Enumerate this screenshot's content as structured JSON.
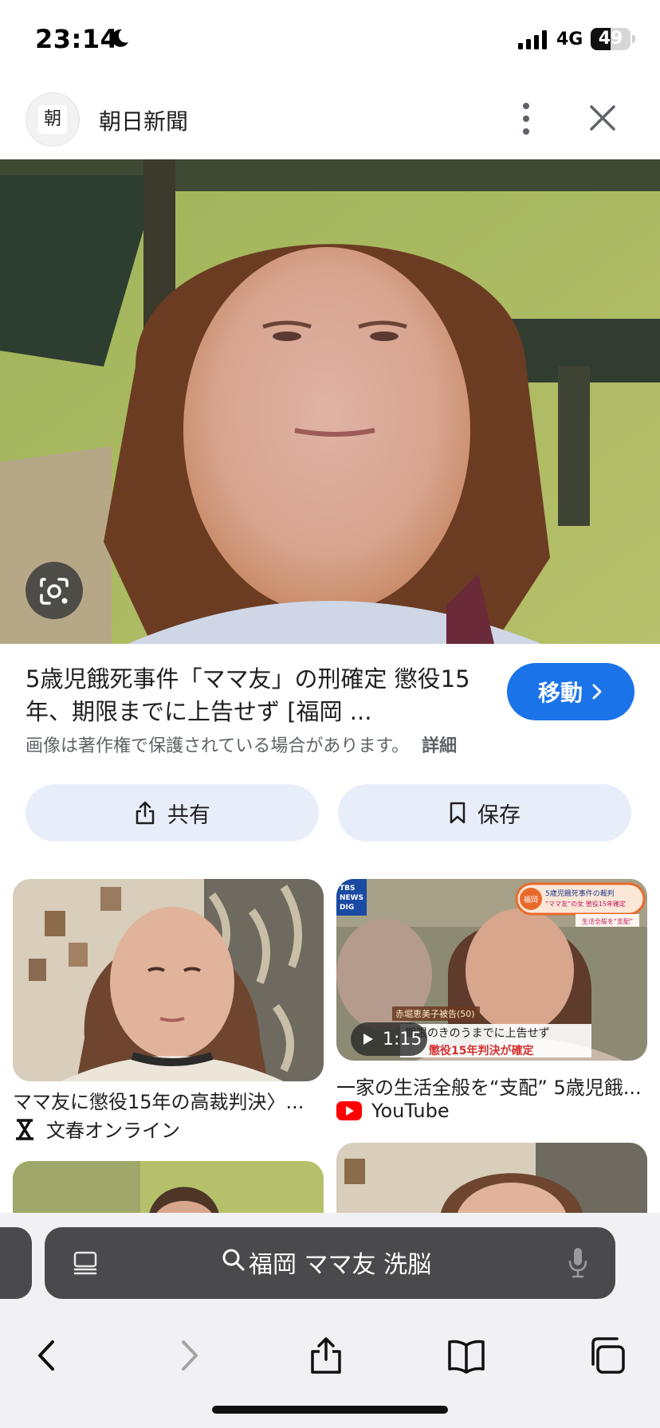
{
  "status_bar": {
    "time": "23:14",
    "network": "4G",
    "battery_percent": 49,
    "battery_text": "49"
  },
  "source": {
    "logo_glyph": "朝",
    "name": "朝日新聞"
  },
  "main": {
    "title": "5歳児餓死事件「ママ友」の刑確定 懲役15年、期限までに上告せず [福岡 ...",
    "visit_label": "移動",
    "copyright_notice": "画像は著作権で保護されている場合があります。",
    "details_label": "詳細",
    "share_label": "共有",
    "save_label": "保存"
  },
  "related": [
    {
      "title": "ママ友に懲役15年の高裁判決〉...",
      "source": "文春オンライン",
      "source_icon": "bunshun-logo-icon"
    },
    {
      "title": "一家の生活全般を“支配” 5歳児餓...",
      "source": "YouTube",
      "source_icon": "youtube-icon",
      "duration": "1:15",
      "overlay": {
        "channel": "TBS NEWS DIG",
        "tag": "福岡",
        "headline_line1": "5歳児餓死事件の裁判",
        "headline_line2": "“ママ友”の女 懲役15年確定",
        "headline_line3": "生活全般を“支配”",
        "caption_name": "赤堀恵美子被告(50)",
        "caption_line1": "期限のきのうまでに上告せず",
        "caption_line2": "懲役15年判決が確定"
      }
    }
  ],
  "browser": {
    "address_text": "福岡 ママ友 洗脳"
  },
  "colors": {
    "accent": "#1a73e8",
    "button_bg": "#e8eef9",
    "address_bar": "#4a4a4c"
  }
}
